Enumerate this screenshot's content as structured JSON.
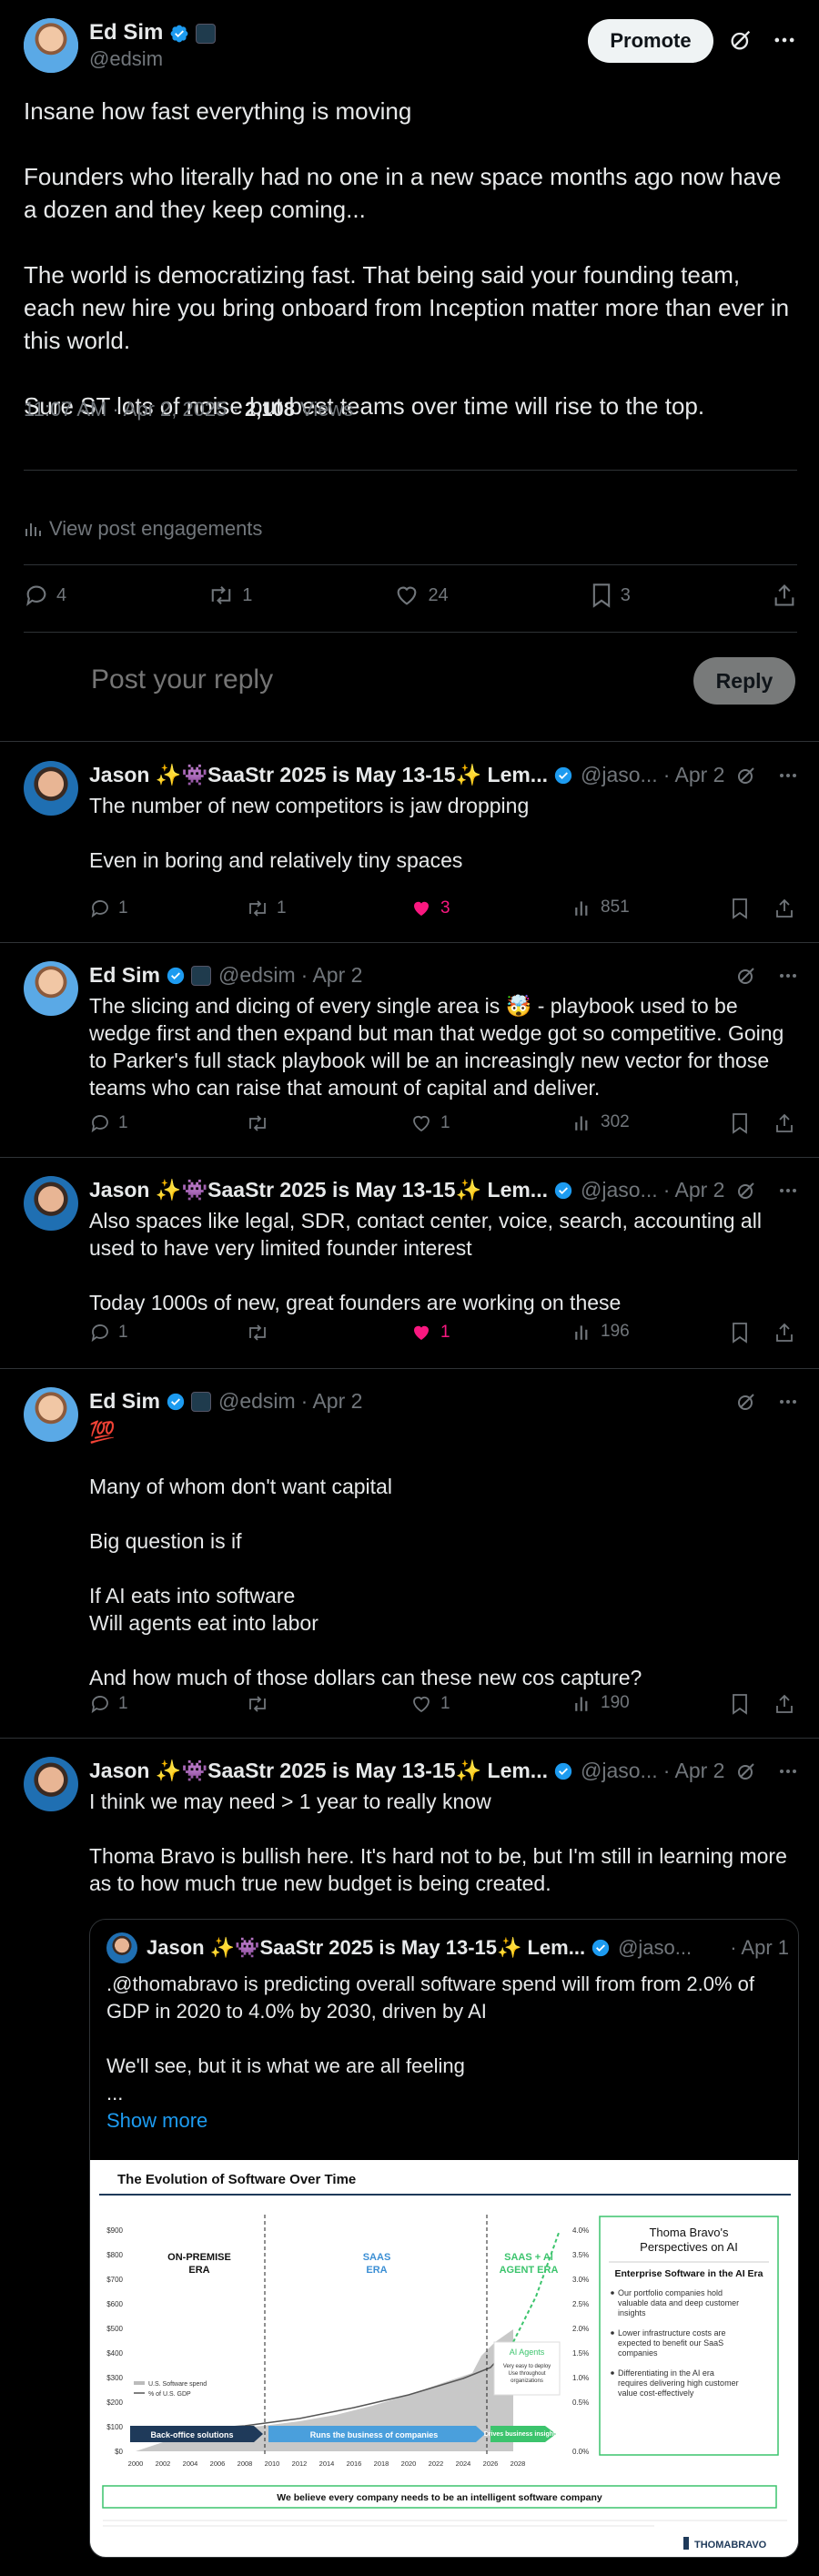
{
  "main_post": {
    "author_name": "Ed Sim",
    "author_handle": "@edsim",
    "promote_label": "Promote",
    "paragraphs": [
      "Insane how fast everything is moving",
      "Founders who literally had no one in a new space months ago now have a dozen and they keep coming...",
      "The world is democratizing fast. That being said your founding team, each new hire you bring onboard from Inception matter more than ever in this world.",
      "Sure ST lots of noise but best teams over time will rise to the top."
    ],
    "timestamp": "11:07 AM · Apr 2, 2025 · ",
    "views_count": "2,108",
    "views_label": " Views",
    "engagements_label": "View post engagements",
    "replies": "4",
    "reposts": "1",
    "likes": "24",
    "bookmarks": "3",
    "reply_placeholder": "Post your reply",
    "reply_button": "Reply"
  },
  "replies": [
    {
      "name": "Jason ✨👾SaaStr 2025 is May 13-15✨ Lem...",
      "handle": "@jaso...",
      "date": "· Apr 2",
      "paragraphs": [
        "The number of new competitors is jaw dropping",
        "Even in boring and relatively tiny spaces"
      ],
      "replies": "1",
      "reposts": "1",
      "likes": "3",
      "views": "851"
    },
    {
      "name": "Ed Sim",
      "handle": "@edsim",
      "date": "· Apr 2",
      "paragraphs": [
        "The slicing and dicing of every single area is 🤯 - playbook used to be wedge first and then expand but man that wedge got so competitive. Going to Parker's full stack playbook will be an increasingly new vector for those teams who can raise that amount of capital and deliver."
      ],
      "replies": "1",
      "reposts": "",
      "likes": "1",
      "views": "302"
    },
    {
      "name": "Jason ✨👾SaaStr 2025 is May 13-15✨ Lem...",
      "handle": "@jaso...",
      "date": "· Apr 2",
      "paragraphs": [
        "Also spaces like legal, SDR, contact center, voice, search, accounting all used to have very limited founder interest",
        "Today 1000s of new, great founders are working on these"
      ],
      "replies": "1",
      "reposts": "",
      "likes": "1",
      "views": "196"
    },
    {
      "name": "Ed Sim",
      "handle": "@edsim",
      "date": "· Apr 2",
      "paragraphs": [
        "💯",
        "Many of whom don't want capital",
        "Big question is if",
        "If AI eats into software\nWill agents eat into labor",
        "And how much of those dollars can these new cos capture?"
      ],
      "replies": "1",
      "reposts": "",
      "likes": "1",
      "views": "190"
    },
    {
      "name": "Jason ✨👾SaaStr 2025 is May 13-15✨ Lem...",
      "handle": "@jaso...",
      "date": "· Apr 2",
      "paragraphs": [
        "I think we may need > 1 year to really know",
        "Thoma Bravo is bullish here.  It's hard not to be, but I'm still in learning more as to how much true new budget is being created."
      ]
    }
  ],
  "quote": {
    "name": "Jason ✨👾SaaStr 2025 is May 13-15✨ Lem...",
    "handle": "@jaso...",
    "date": "· Apr 1",
    "paragraphs": [
      ".@thomabravo is predicting overall software spend will from from 2.0% of GDP in 2020 to 4.0% by 2030, driven by AI",
      "We'll see, but it is what we are all feeling\n..."
    ],
    "show_more": "Show more",
    "image": {
      "title": "The Evolution of Software Over Time",
      "eras": [
        "ON-PREMISE\nERA",
        "SAAS\nERA",
        "SAAS + AI\nAGENT ERA"
      ],
      "ai_agents": "AI Agents",
      "ai_agents_sub": "Very easy to deploy\nUse throughout\norganizations",
      "legend": [
        "U.S. Software spend",
        "% of U.S. GDP"
      ],
      "arrows": [
        "Back-office solutions",
        "Runs the business of companies",
        "Drives business insights"
      ],
      "yleft": [
        "$900",
        "$800",
        "$700",
        "$600",
        "$500",
        "$400",
        "$300",
        "$200",
        "$100",
        "$0"
      ],
      "yright": [
        "4.0%",
        "3.5%",
        "3.0%",
        "2.5%",
        "2.0%",
        "1.5%",
        "1.0%",
        "0.5%",
        "0.0%"
      ],
      "xticks": [
        "2000",
        "2002",
        "2004",
        "2006",
        "2008",
        "2010",
        "2012",
        "2014",
        "2016",
        "2018",
        "2020",
        "2022",
        "2024",
        "2026",
        "2028"
      ],
      "panel_title": "Thoma Bravo's\nPerspectives on AI",
      "panel_subtitle": "Enterprise Software in the AI Era",
      "panel_bullets": [
        "Our portfolio companies hold valuable data and deep customer insights",
        "Lower infrastructure costs are expected to benefit our SaaS companies",
        "Differentiating in the AI era requires delivering high customer value cost-effectively"
      ],
      "banner": "We believe every company needs to be an intelligent software company",
      "brand": "THOMABRAVO"
    }
  },
  "colors": {
    "background": "#000000",
    "text": "#e7e9ea",
    "muted": "#71767b",
    "accent": "#1d9bf0",
    "like": "#f91880",
    "border": "#2f3336"
  }
}
